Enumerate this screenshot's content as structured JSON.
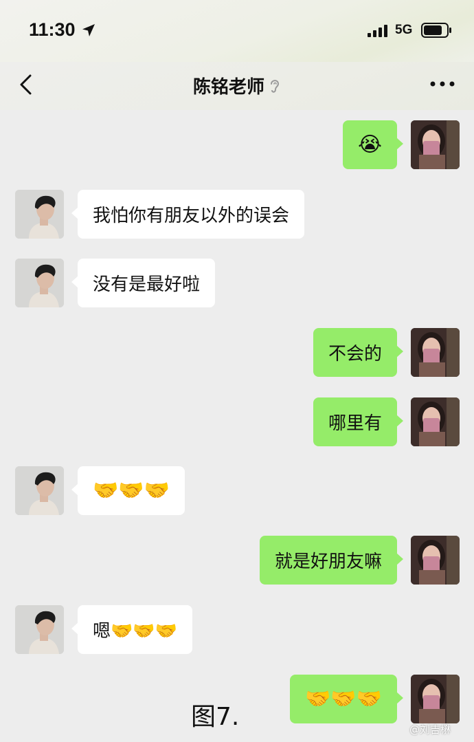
{
  "status_bar": {
    "time": "11:30",
    "network": "5G"
  },
  "header": {
    "title": "陈铭老师"
  },
  "messages": [
    {
      "side": "out",
      "text": "😭"
    },
    {
      "side": "in",
      "text": "我怕你有朋友以外的误会"
    },
    {
      "side": "in",
      "text": "没有是最好啦"
    },
    {
      "side": "out",
      "text": "不会的"
    },
    {
      "side": "out",
      "text": "哪里有"
    },
    {
      "side": "in",
      "text": "🤝🤝🤝"
    },
    {
      "side": "out",
      "text": "就是好朋友嘛"
    },
    {
      "side": "in",
      "text": "嗯🤝🤝🤝"
    },
    {
      "side": "out",
      "text": "🤝🤝🤝"
    }
  ],
  "caption": "图7.",
  "watermark": "@刘吉楙",
  "colors": {
    "incoming_bubble": "#ffffff",
    "outgoing_bubble": "#95ec69",
    "background": "#ededed"
  },
  "icons": [
    "location-arrow-icon",
    "signal-bars-icon",
    "battery-icon",
    "back-chevron-icon",
    "ear-icon",
    "more-dots-icon"
  ]
}
